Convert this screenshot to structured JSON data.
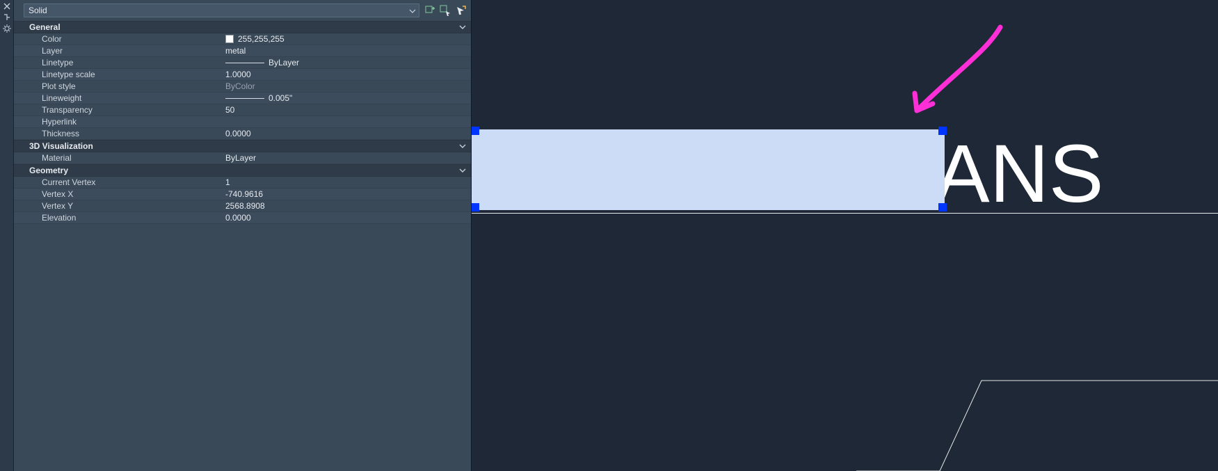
{
  "panel": {
    "objectType": "Solid",
    "sections": {
      "general": {
        "title": "General",
        "rows": {
          "color": {
            "label": "Color",
            "value": "255,255,255"
          },
          "layer": {
            "label": "Layer",
            "value": "metal"
          },
          "linetype": {
            "label": "Linetype",
            "value": "ByLayer"
          },
          "ltscale": {
            "label": "Linetype scale",
            "value": "1.0000"
          },
          "plotstyle": {
            "label": "Plot style",
            "value": "ByColor"
          },
          "lineweight": {
            "label": "Lineweight",
            "value": "0.005\""
          },
          "transparency": {
            "label": "Transparency",
            "value": "50"
          },
          "hyperlink": {
            "label": "Hyperlink",
            "value": ""
          },
          "thickness": {
            "label": "Thickness",
            "value": "0.0000"
          }
        }
      },
      "vis3d": {
        "title": "3D Visualization",
        "rows": {
          "material": {
            "label": "Material",
            "value": "ByLayer"
          }
        }
      },
      "geometry": {
        "title": "Geometry",
        "rows": {
          "cvertex": {
            "label": "Current Vertex",
            "value": "1"
          },
          "vx": {
            "label": "Vertex X",
            "value": "-740.9616"
          },
          "vy": {
            "label": "Vertex Y",
            "value": "2568.8908"
          },
          "elevation": {
            "label": "Elevation",
            "value": "0.0000"
          }
        }
      }
    }
  },
  "canvas": {
    "visibleText": "ANS"
  }
}
